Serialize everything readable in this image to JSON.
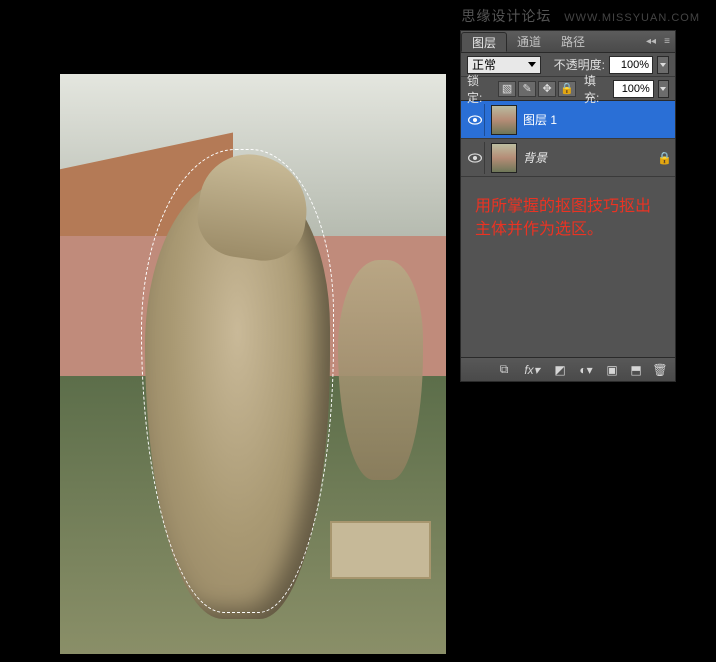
{
  "watermark": {
    "cn": "思缘设计论坛",
    "url": "WWW.MISSYUAN.COM"
  },
  "panel": {
    "tabs": {
      "layers": "图层",
      "channels": "通道",
      "paths": "路径"
    },
    "blend_mode": "正常",
    "opacity_label": "不透明度:",
    "opacity_value": "100%",
    "lock_label": "锁定:",
    "fill_label": "填充:",
    "fill_value": "100%",
    "lock_icons": {
      "pixels": "▧",
      "brush": "✎",
      "move": "✥",
      "all": "🔒"
    },
    "layers": [
      {
        "name": "图层 1",
        "locked": false,
        "visible": true,
        "selected": true
      },
      {
        "name": "背景",
        "locked": true,
        "visible": true,
        "selected": false,
        "italic": true
      }
    ],
    "footer_icons": {
      "link": "⧉",
      "fx": "fx▾",
      "mask": "◩",
      "adjust": "◐▾",
      "group": "▣",
      "new": "⬒",
      "trash": "🗑"
    }
  },
  "instruction": {
    "line1": "用所掌握的抠图技巧抠出",
    "line2": "主体并作为选区。"
  }
}
